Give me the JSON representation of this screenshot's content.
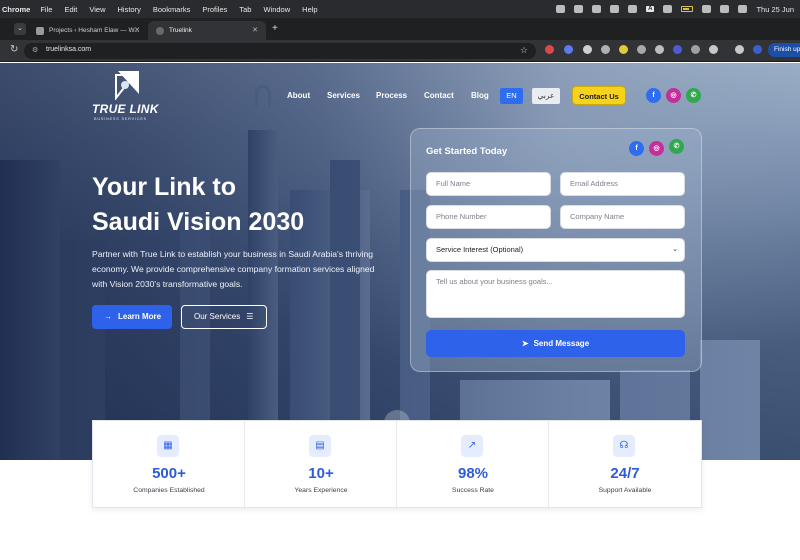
{
  "menubar": {
    "app": "Chrome",
    "items": [
      "File",
      "Edit",
      "View",
      "History",
      "Bookmarks",
      "Profiles",
      "Tab",
      "Window",
      "Help"
    ],
    "clock": "Thu 25 Jun"
  },
  "browser": {
    "tabs": [
      {
        "label": "Projects ‹ Hesham Elaw — W..."
      },
      {
        "label": "Truelink",
        "active": true
      }
    ],
    "url": "truelinksa.com",
    "profile_button": "Finish up"
  },
  "site": {
    "brand": {
      "name": "TRUE LINK",
      "tagline": "BUSINESS SERVICES"
    },
    "nav": [
      "About",
      "Services",
      "Process",
      "Contact",
      "Blog"
    ],
    "lang_en": "EN",
    "lang_ar": "عربي",
    "contact_button": "Contact Us",
    "social": {
      "facebook": "f",
      "instagram": "◎",
      "whatsapp": "✆"
    },
    "hero": {
      "title_line1": "Your Link to",
      "title_line2": "Saudi Vision 2030",
      "description": "Partner with True Link to establish your business in Saudi Arabia's thriving economy. We provide comprehensive company formation services aligned with Vision 2030's transformative goals.",
      "primary_cta": "Learn More",
      "secondary_cta": "Our Services"
    },
    "form": {
      "title": "Get Started Today",
      "full_name_placeholder": "Full Name",
      "email_placeholder": "Email Address",
      "phone_placeholder": "Phone Number",
      "company_placeholder": "Company Name",
      "service_selected": "Service Interest (Optional)",
      "message_placeholder": "Tell us about your business goals...",
      "submit": "Send Message"
    },
    "stats": [
      {
        "value": "500+",
        "label": "Companies Established",
        "icon": "building-icon"
      },
      {
        "value": "10+",
        "label": "Years Experience",
        "icon": "calendar-icon"
      },
      {
        "value": "98%",
        "label": "Success Rate",
        "icon": "chart-icon"
      },
      {
        "value": "24/7",
        "label": "Support Available",
        "icon": "headset-icon"
      }
    ]
  },
  "colors": {
    "accent": "#2f62ea",
    "cta_yellow": "#f6d21b"
  }
}
